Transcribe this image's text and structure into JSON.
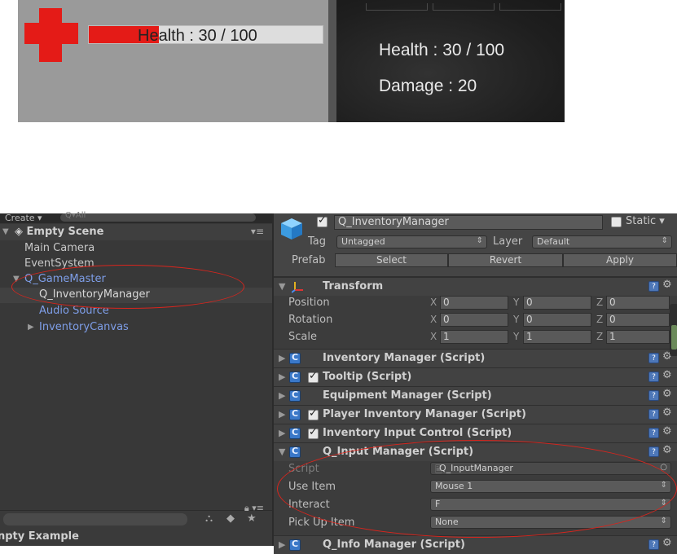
{
  "game": {
    "hud_health_text": "Health : 30 / 100",
    "health_fraction": 0.3,
    "stats": [
      {
        "text": "Health : 30 / 100"
      },
      {
        "text": "Damage : 20"
      }
    ]
  },
  "hierarchy": {
    "create_label": "Create ▾",
    "search_placeholder": "Q▾All",
    "scene_name": "Empty Scene",
    "scene_menu": "▾≡",
    "items": [
      {
        "label": "Main Camera"
      },
      {
        "label": "EventSystem"
      },
      {
        "label": "Q_GameMaster"
      },
      {
        "label": "Q_InventoryManager"
      },
      {
        "label": "Audio Source"
      },
      {
        "label": "InventoryCanvas"
      }
    ],
    "project_label": "npty Example"
  },
  "inspector": {
    "object_name": "Q_InventoryManager",
    "static_label": "Static ▾",
    "tag_label": "Tag",
    "tag_value": "Untagged",
    "layer_label": "Layer",
    "layer_value": "Default",
    "prefab_label": "Prefab",
    "prefab_buttons": [
      "Select",
      "Revert",
      "Apply"
    ],
    "transform": {
      "title": "Transform",
      "rows": [
        {
          "label": "Position",
          "x": "0",
          "y": "0",
          "z": "0"
        },
        {
          "label": "Rotation",
          "x": "0",
          "y": "0",
          "z": "0"
        },
        {
          "label": "Scale",
          "x": "1",
          "y": "1",
          "z": "1"
        }
      ]
    },
    "components": [
      {
        "title": "Inventory Manager (Script)"
      },
      {
        "title": "Tooltip (Script)"
      },
      {
        "title": "Equipment Manager (Script)"
      },
      {
        "title": "Player Inventory Manager (Script)"
      },
      {
        "title": "Inventory Input Control (Script)"
      },
      {
        "title": "Q_Input Manager (Script)"
      }
    ],
    "input_manager": {
      "script_label": "Script",
      "script_value": "Q_InputManager",
      "use_item_label": "Use Item",
      "use_item_value": "Mouse 1",
      "interact_label": "Interact",
      "interact_value": "F",
      "pickup_label": "Pick Up Item",
      "pickup_value": "None"
    },
    "next_component": "Q_Info Manager (Script)"
  },
  "colors": {
    "health_red": "#e41b17",
    "annotation_red": "#d9251d",
    "editor_bg": "#383838",
    "inspector_bg": "#3c3c3c"
  }
}
